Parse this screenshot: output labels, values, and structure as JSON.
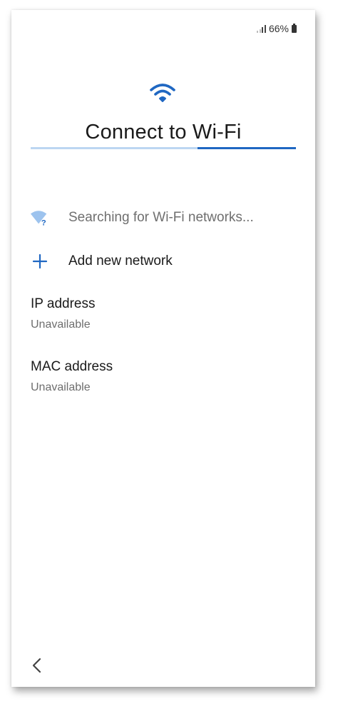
{
  "status_bar": {
    "battery": "66%",
    "icons": [
      "signal-icon",
      "battery-icon"
    ]
  },
  "header": {
    "icon": "wifi-icon",
    "title": "Connect to Wi-Fi",
    "progress": 0.63
  },
  "list": {
    "searching_text": "Searching for Wi-Fi networks...",
    "searching_icon": "wifi-searching-icon",
    "add_network_label": "Add new network",
    "add_icon": "plus-icon"
  },
  "info": {
    "ip_label": "IP address",
    "ip_value": "Unavailable",
    "mac_label": "MAC address",
    "mac_value": "Unavailable"
  },
  "nav": {
    "back_icon": "chevron-left-icon"
  },
  "colors": {
    "accent": "#1f67c2",
    "accent_light": "#bcd6f2",
    "text_primary": "#1a1a1a",
    "text_secondary": "#6e6e6e"
  }
}
